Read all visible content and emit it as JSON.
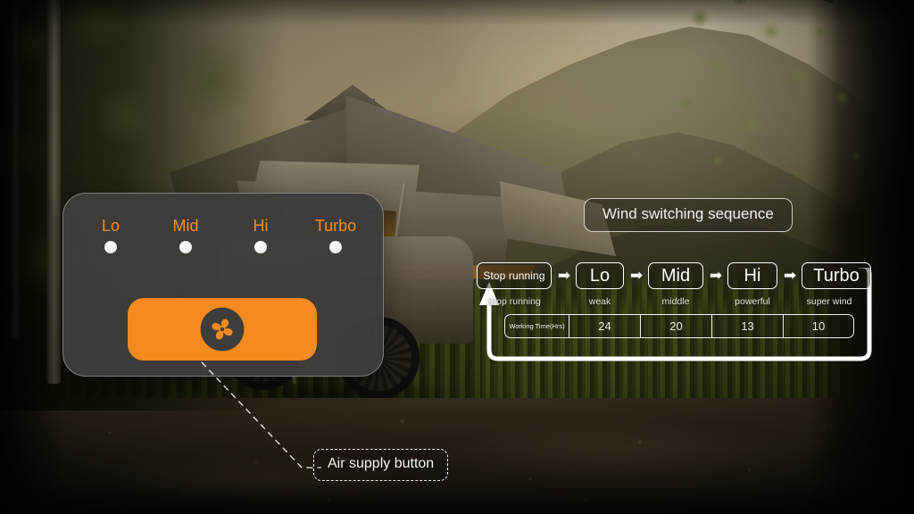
{
  "panel": {
    "indicators": [
      {
        "label": "Lo",
        "state": "off"
      },
      {
        "label": "Mid",
        "state": "off"
      },
      {
        "label": "Hi",
        "state": "off"
      },
      {
        "label": "Turbo",
        "state": "off"
      }
    ],
    "air_button": {
      "icon": "fan-icon",
      "color": "#f58a1f"
    },
    "callout": "Air supply button"
  },
  "diagram": {
    "title": "Wind switching sequence",
    "arrow_glyph": "➡",
    "nodes": [
      {
        "label": "Stop running",
        "size": "small"
      },
      {
        "label": "Lo",
        "size": "big"
      },
      {
        "label": "Mid",
        "size": "big"
      },
      {
        "label": "Hi",
        "size": "big"
      },
      {
        "label": "Turbo",
        "size": "big"
      }
    ],
    "sublabels": [
      "Stop running",
      "weak",
      "middle",
      "powerful",
      "super wind"
    ],
    "table": {
      "header": "Working Time(Hrs)",
      "values": [
        "24",
        "20",
        "13",
        "10"
      ]
    }
  },
  "colors": {
    "accent_orange": "#f58a1f",
    "label_orange": "#f28d20",
    "panel_gray": "#3e3d3b",
    "line_white": "#ffffff"
  }
}
